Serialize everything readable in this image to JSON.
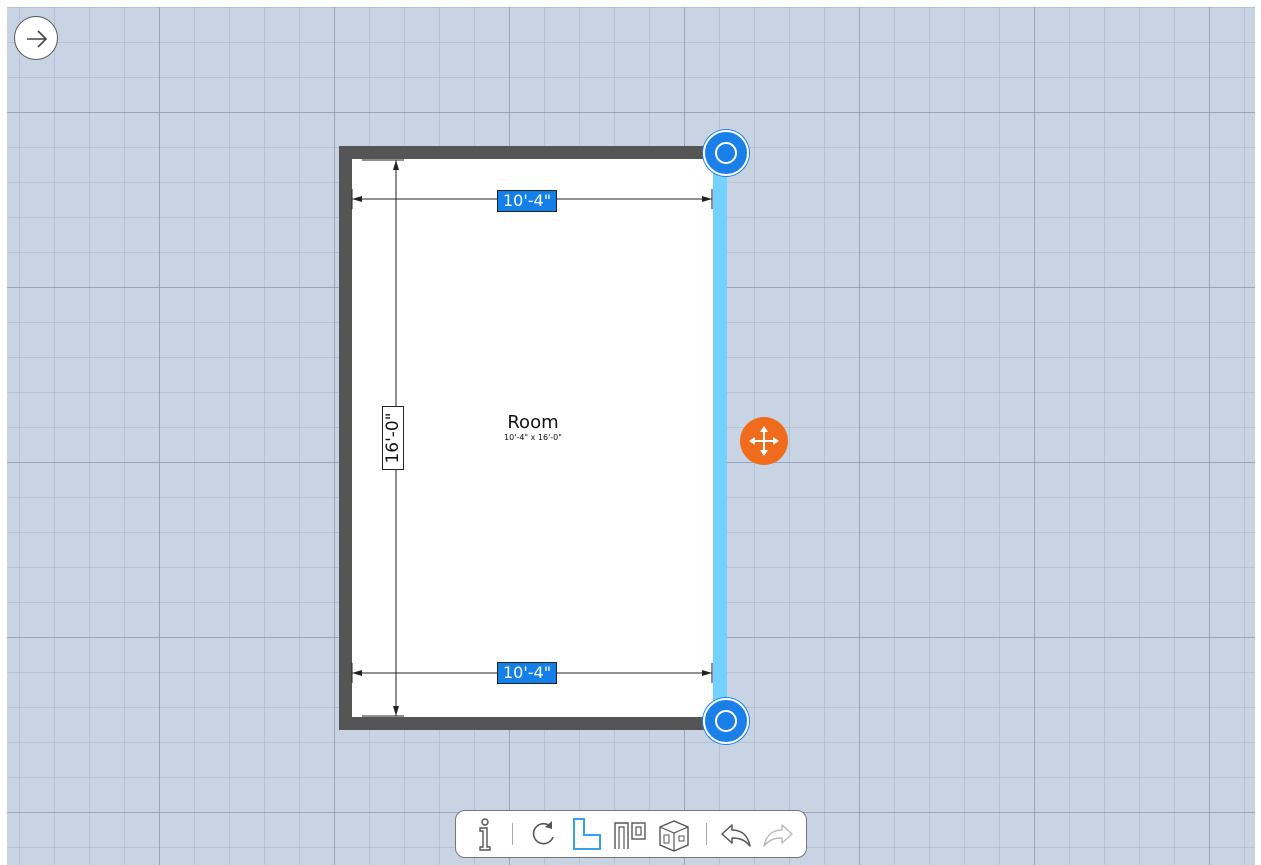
{
  "room": {
    "name": "Room",
    "dimensions": "10'-4\" x 16'-0\"",
    "width_top": "10'-4\"",
    "width_bottom": "10'-4\"",
    "height": "16'-0\""
  },
  "colors": {
    "canvas_bg": "#c8d3e3",
    "wall": "#555555",
    "selected_wall": "#72d1ff",
    "handle": "#1a7fe8",
    "move_handle": "#f06c1c",
    "dimension_badge": "#1280e8"
  },
  "toolbar": {
    "items": [
      {
        "name": "info-icon"
      },
      {
        "name": "rotate-icon"
      },
      {
        "name": "room-shape-icon",
        "active": true
      },
      {
        "name": "doors-windows-icon"
      },
      {
        "name": "3d-view-icon"
      },
      {
        "name": "undo-icon"
      },
      {
        "name": "redo-icon",
        "disabled": true
      }
    ]
  },
  "nav": {
    "back_icon": "arrow-right-icon"
  }
}
